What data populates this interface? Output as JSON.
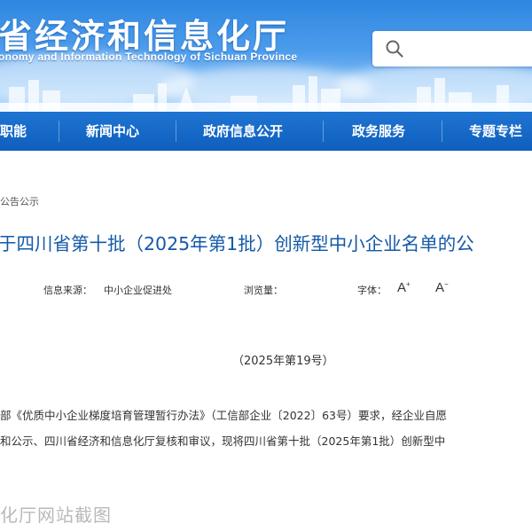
{
  "header": {
    "site_title": "省经济和信息化厅",
    "site_subtitle": "onomy and Information Technology of Sichuan Province",
    "search": {
      "placeholder": ""
    }
  },
  "nav": {
    "items": [
      {
        "label": "职能"
      },
      {
        "label": "新闻中心"
      },
      {
        "label": "政府信息公开"
      },
      {
        "label": "政务服务"
      },
      {
        "label": "专题专栏"
      }
    ]
  },
  "breadcrumb": "公告公示",
  "article": {
    "title": "于四川省第十批（2025年第1批）创新型中小企业名单的公",
    "meta": {
      "source_label": "信息来源：",
      "source_value": "中小企业促进处",
      "views_label": "浏览量：",
      "font_label": "字体："
    },
    "font_increase": "A",
    "font_decrease": "A",
    "doc_number": "（2025年第19号）",
    "paragraphs": [
      "部《优质中小企业梯度培育管理暂行办法》（工信部企业〔2022〕63号）要求，经企业自愿",
      "和公示、四川省经济和信息化厅复核和审议，现将四川省第十批（2025年第1批）创新型中"
    ]
  },
  "watermark": "化厅网站截图"
}
